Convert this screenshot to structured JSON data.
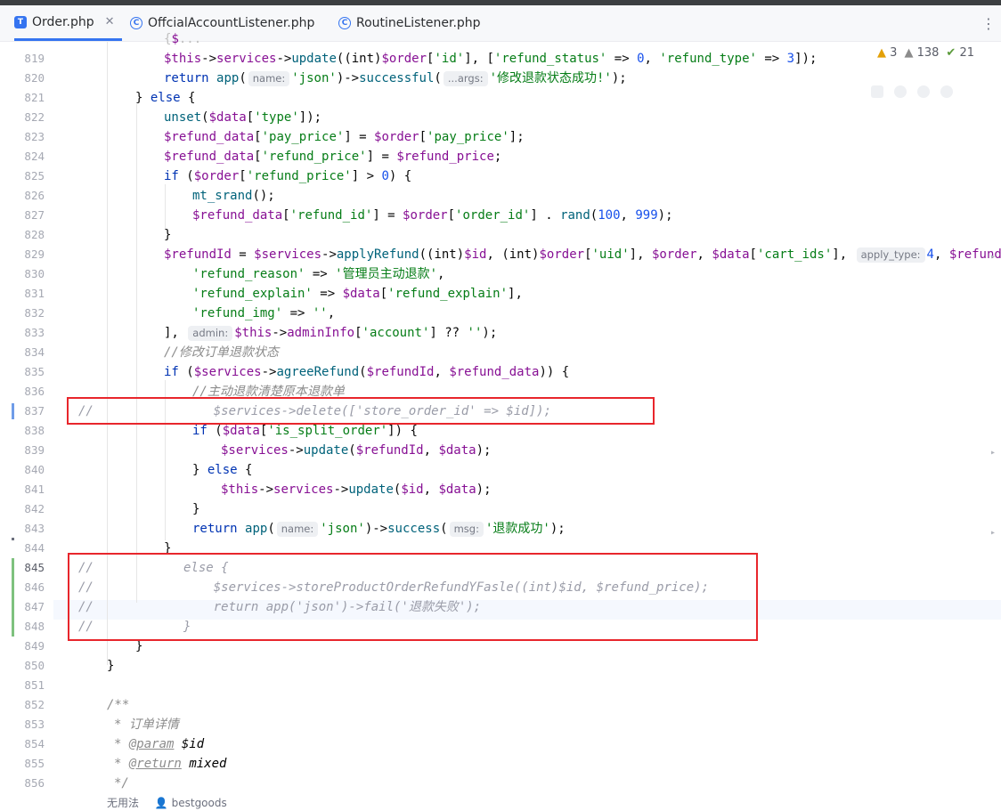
{
  "tabs": [
    {
      "label": "Order.php",
      "icon": "php-class-icon",
      "active": true,
      "closable": true
    },
    {
      "label": "OffcialAccountListener.php",
      "icon": "php-class-icon",
      "active": false
    },
    {
      "label": "RoutineListener.php",
      "icon": "php-class-icon",
      "active": false
    }
  ],
  "inspection": {
    "warnings": "3",
    "weak_warnings": "138",
    "typos": "21"
  },
  "lines": {
    "819": "819",
    "820": "820",
    "821": "821",
    "822": "822",
    "823": "823",
    "824": "824",
    "825": "825",
    "826": "826",
    "827": "827",
    "828": "828",
    "829": "829",
    "830": "830",
    "831": "831",
    "832": "832",
    "833": "833",
    "834": "834",
    "835": "835",
    "836": "836",
    "837": "837",
    "838": "838",
    "839": "839",
    "840": "840",
    "841": "841",
    "842": "842",
    "843": "843",
    "844": "844",
    "845": "845",
    "846": "846",
    "847": "847",
    "848": "848",
    "849": "849",
    "850": "850",
    "851": "851",
    "852": "852",
    "853": "853",
    "854": "854",
    "855": "855",
    "856": "856"
  },
  "code": {
    "l819": [
      "$this",
      "->",
      "services",
      "->",
      "update",
      "((int)",
      "$order",
      "[",
      "'id'",
      "], [",
      "'refund_status'",
      " => ",
      "0",
      ", ",
      "'refund_type'",
      " => ",
      "3",
      "]);"
    ],
    "l820_hint1": "name:",
    "l820_hint2": "...args:",
    "l820_str1": "'json'",
    "l820_str2": "'修改退款状态成功!'",
    "l834_comment": "//修改订单退款状态",
    "l836_comment": "//主动退款清楚原本退款单",
    "l837_text": "//                $services->delete(['store_order_id' => $id]);",
    "l845_text": "//            else {",
    "l846_text": "//                $services->storeProductOrderRefundYFasle((int)$id, $refund_price);",
    "l847_text": "//                return app('json')->fail('退款失败');",
    "l848_text": "//            }",
    "l830_str": "'管理员主动退款'",
    "l843_str": "'退款成功'",
    "hints": {
      "admin": "admin:",
      "apply_type": "apply_type:",
      "msg": "msg:",
      "name": "name:"
    },
    "doc853": "* 订单详情",
    "doc854_tag": "@param",
    "doc854_var": "$id",
    "doc855_tag": "@return",
    "doc855_type": "mixed"
  },
  "footer": {
    "usages": "无用法",
    "author": "bestgoods"
  }
}
